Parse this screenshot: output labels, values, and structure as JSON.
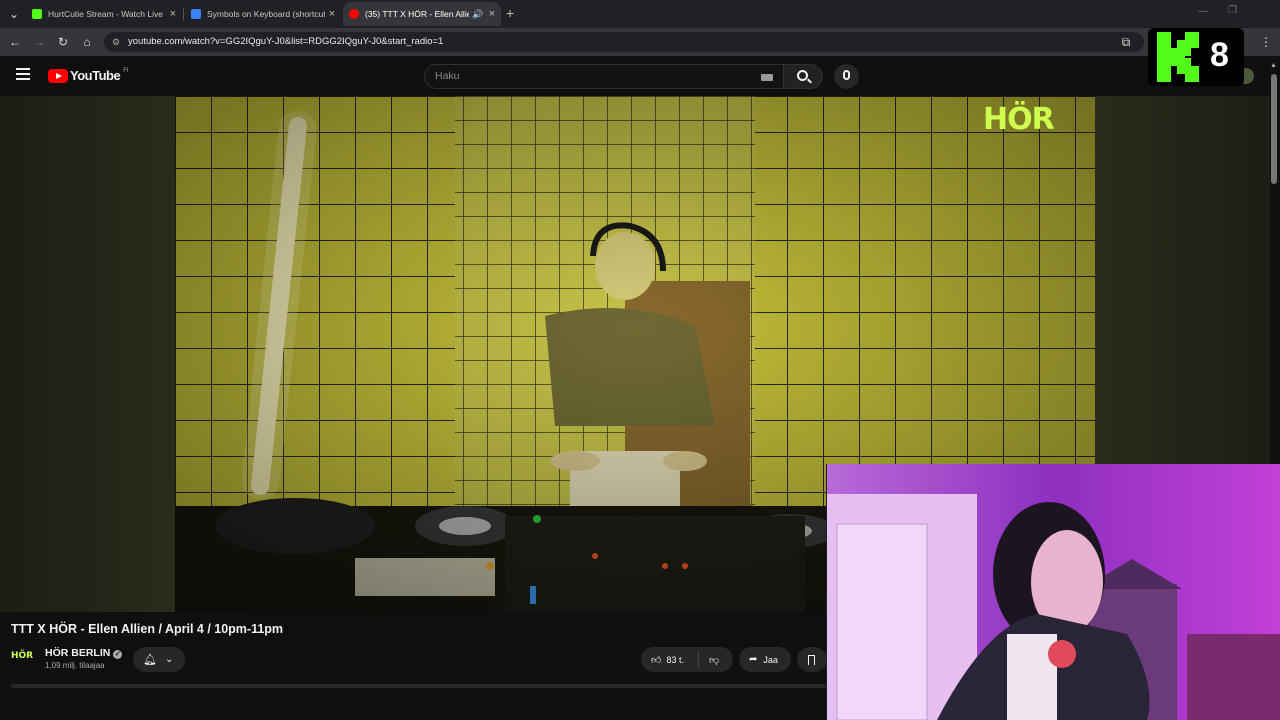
{
  "browser": {
    "tabs": [
      {
        "label": "HurtCutie Stream - Watch Live",
        "favicon_color": "#53fc18",
        "active": false
      },
      {
        "label": "Symbols on Keyboard (shortcut",
        "favicon_color": "#3b82f6",
        "active": false
      },
      {
        "label": "(35) TTT X HÖR - Ellen Allie",
        "favicon_color": "#ff0000",
        "active": true
      }
    ],
    "new_tab": "+",
    "url": "youtube.com/watch?v=GG2IQguY-J0&list=RDGG2IQguY-J0&start_radio=1"
  },
  "youtube": {
    "logo_text": "YouTube",
    "region": "FI",
    "search_placeholder": "Haku"
  },
  "video": {
    "watermark": "HÖR",
    "title": "TTT X HÖR - Ellen Allien / April 4 / 10pm-11pm",
    "channel": {
      "name": "HÖR BERLIN",
      "logo": "HÖR",
      "subscribers": "1,09 milj. tilaajaa"
    },
    "likes": "83 t.",
    "share": "Jaa"
  },
  "overlay": {
    "k8_digit": "8"
  },
  "colors": {
    "accent_red": "#ff0000",
    "kick_green": "#53fc18",
    "hor_yellow": "#cfff4f"
  }
}
